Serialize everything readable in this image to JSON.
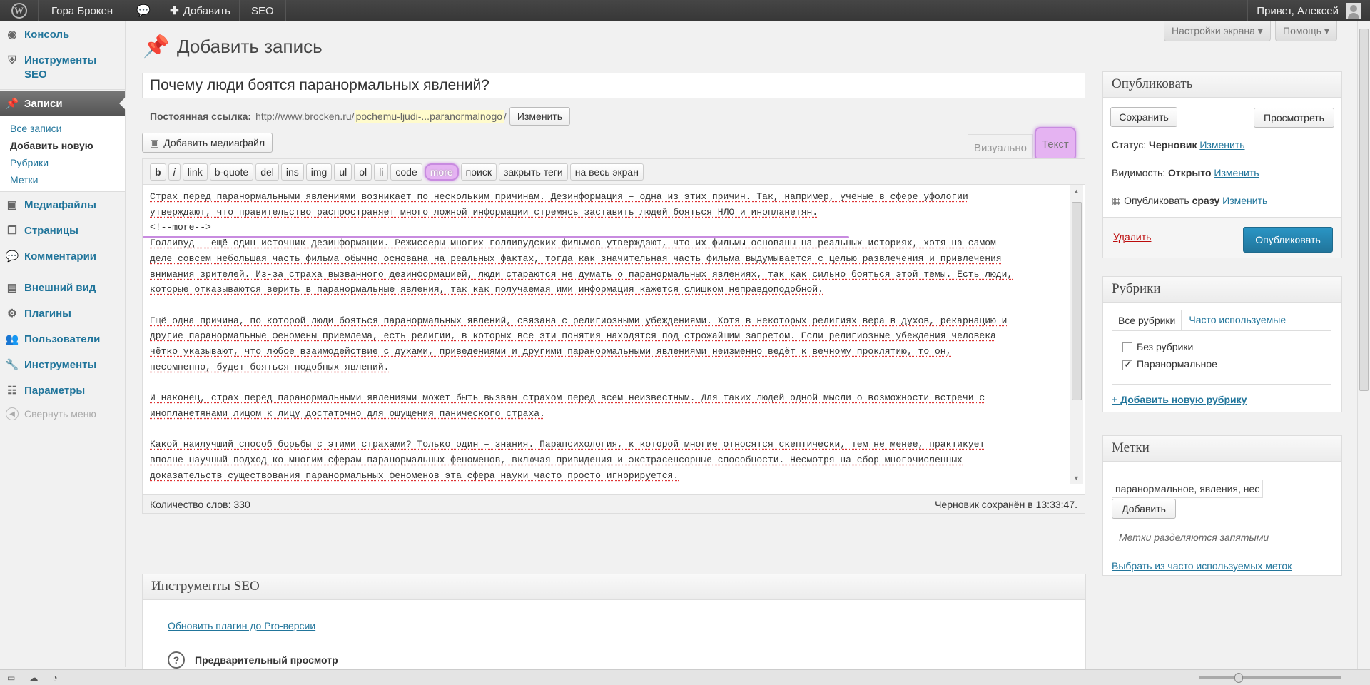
{
  "adminbar": {
    "site": "Гора Брокен",
    "add": "Добавить",
    "seo": "SEO",
    "greeting": "Привет, Алексей"
  },
  "menu": {
    "items": [
      {
        "label": "Консоль"
      },
      {
        "label": "Инструменты SEO"
      },
      {
        "label": "Записи"
      },
      {
        "label": "Медиафайлы"
      },
      {
        "label": "Страницы"
      },
      {
        "label": "Комментарии"
      },
      {
        "label": "Внешний вид"
      },
      {
        "label": "Плагины"
      },
      {
        "label": "Пользователи"
      },
      {
        "label": "Инструменты"
      },
      {
        "label": "Параметры"
      }
    ],
    "sub": [
      "Все записи",
      "Добавить новую",
      "Рубрики",
      "Метки"
    ],
    "collapse": "Свернуть меню"
  },
  "page": {
    "title": "Добавить запись",
    "screen_options": "Настройки экрана ▾",
    "help": "Помощь ▾",
    "post_title": "Почему люди боятся паранормальных явлений?",
    "permalink_label": "Постоянная ссылка:",
    "permalink_url": "http://www.brocken.ru/",
    "permalink_slug": "pochemu-ljudi-...paranormalnogo",
    "permalink_end": "/",
    "edit_slug": "Изменить",
    "add_media": "Добавить медиафайл",
    "tab_visual": "Визуально",
    "tab_text": "Текст"
  },
  "quicktags": [
    "b",
    "i",
    "link",
    "b-quote",
    "del",
    "ins",
    "img",
    "ul",
    "ol",
    "li",
    "code",
    "more",
    "поиск",
    "закрыть теги",
    "на весь экран"
  ],
  "content": {
    "lines1": [
      "Страх перед паранормальными явлениями возникает по нескольким причинам. Дезинформация – одна из этих причин. Так, например, учёные в сфере уфологии",
      "утверждают, что правительство распространяет много ложной информации стремясь заставить людей бояться НЛО и инопланетян."
    ],
    "more_tag": "<!--more-->",
    "lines2": [
      "Голливуд – ещё один источник дезинформации. Режиссеры многих голливудских фильмов утверждают, что их фильмы основаны на реальных историях, хотя на самом",
      "деле совсем небольшая часть фильма обычно основана на реальных фактах, тогда как значительная часть фильма выдумывается с целью развлечения и привлечения",
      "внимания зрителей. Из-за страха вызванного дезинформацией, люди стараются не думать о паранормальных явлениях, так как сильно бояться этой темы. Есть люди,",
      "которые отказываются верить в паранормальные явления, так как получаемая ими информация кажется слишком неправдоподобной."
    ],
    "lines3": [
      "Ещё одна причина, по которой люди бояться паранормальных явлений, связана с религиозными убеждениями. Хотя в некоторых религиях вера в духов, рекарнацию и",
      "другие паранормальные феномены приемлема, есть религии, в которых все эти понятия находятся под строжайшим запретом. Если религиозные убеждения человека",
      "чётко указывают, что любое взаимодействие с духами, приведениями и другими паранормальными явлениями неизменно ведёт к вечному проклятию, то он,",
      "несомненно, будет бояться подобных явлений."
    ],
    "lines4": [
      "И наконец, страх перед паранормальными явлениями может быть вызван страхом перед всем неизвестным. Для таких людей одной мысли о возможности встречи с",
      "инопланетянами лицом к лицу достаточно для ощущения панического страха."
    ],
    "lines5": [
      "Какой наилучший способ борьбы с этими страхами? Только один – знания. Парапсихология, к которой многие относятся скептически, тем не менее, практикует",
      "вполне научный подход ко многим сферам паранормальных феноменов, включая привидения и экстрасенсорные способности. Несмотря на сбор многочисленных",
      "доказательств существования паранормальных феноменов эта сфера науки часто просто игнорируется."
    ]
  },
  "editor_footer": {
    "word_count": "Количество слов: 330",
    "saved": "Черновик сохранён в 13:33:47."
  },
  "publish": {
    "title": "Опубликовать",
    "save": "Сохранить",
    "preview": "Просмотреть",
    "status_label": "Статус:",
    "status_value": "Черновик",
    "visibility_label": "Видимость:",
    "visibility_value": "Открыто",
    "publish_label": "Опубликовать",
    "publish_value": "сразу",
    "change": "Изменить",
    "delete": "Удалить",
    "publish_btn": "Опубликовать"
  },
  "categories": {
    "title": "Рубрики",
    "tab_all": "Все рубрики",
    "tab_popular": "Часто используемые",
    "items": [
      {
        "label": "Без рубрики",
        "checked": false
      },
      {
        "label": "Паранормальное",
        "checked": true
      }
    ],
    "add_new": "+ Добавить новую рубрику"
  },
  "tags": {
    "title": "Метки",
    "input_value": "паранормальное, явления, нео",
    "add": "Добавить",
    "hint": "Метки разделяются запятыми",
    "choose": "Выбрать из часто используемых меток"
  },
  "seo_box": {
    "title": "Инструменты SEO",
    "upgrade": "Обновить плагин до Pro-версии",
    "preview": "Предварительный просмотр"
  }
}
